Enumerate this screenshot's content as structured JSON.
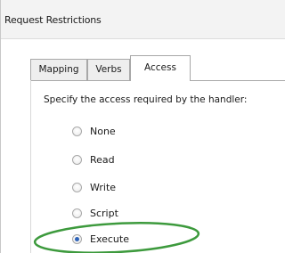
{
  "window": {
    "title": "Request Restrictions"
  },
  "tabs": [
    {
      "label": "Mapping",
      "active": false
    },
    {
      "label": "Verbs",
      "active": false
    },
    {
      "label": "Access",
      "active": true
    }
  ],
  "access_panel": {
    "prompt": "Specify the access required by the handler:",
    "options": [
      {
        "label": "None",
        "selected": false
      },
      {
        "label": "Read",
        "selected": false
      },
      {
        "label": "Write",
        "selected": false
      },
      {
        "label": "Script",
        "selected": false
      },
      {
        "label": "Execute",
        "selected": true
      }
    ]
  },
  "colors": {
    "highlight_ellipse": "#3d9a3d",
    "radio_selected": "#2f63b8"
  }
}
